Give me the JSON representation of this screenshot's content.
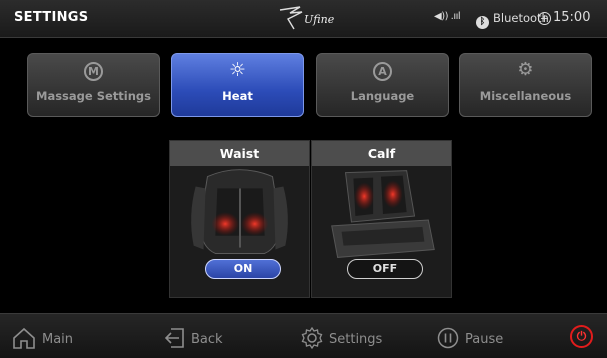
{
  "status": {
    "title": "SETTINGS",
    "logo_text": "Ufine",
    "signal": "◀)) .ııl",
    "bluetooth": "Bluetooth",
    "time": "15:00"
  },
  "tabs": [
    {
      "label": "Massage Settings",
      "icon": "M",
      "icon_name": "massage-settings-icon",
      "active": false
    },
    {
      "label": "Heat",
      "icon": "☼",
      "icon_name": "sun-icon",
      "active": true
    },
    {
      "label": "Language",
      "icon": "A",
      "icon_name": "language-icon",
      "active": false
    },
    {
      "label": "Miscellaneous",
      "icon": "⚙",
      "icon_name": "gear-icon",
      "active": false
    }
  ],
  "heat": {
    "waist": {
      "title": "Waist",
      "state": "ON"
    },
    "calf": {
      "title": "Calf",
      "state": "OFF"
    }
  },
  "nav": {
    "main": "Main",
    "back": "Back",
    "settings": "Settings",
    "pause": "Pause"
  },
  "colors": {
    "accent": "#3552c4",
    "power": "#e21c1c"
  }
}
